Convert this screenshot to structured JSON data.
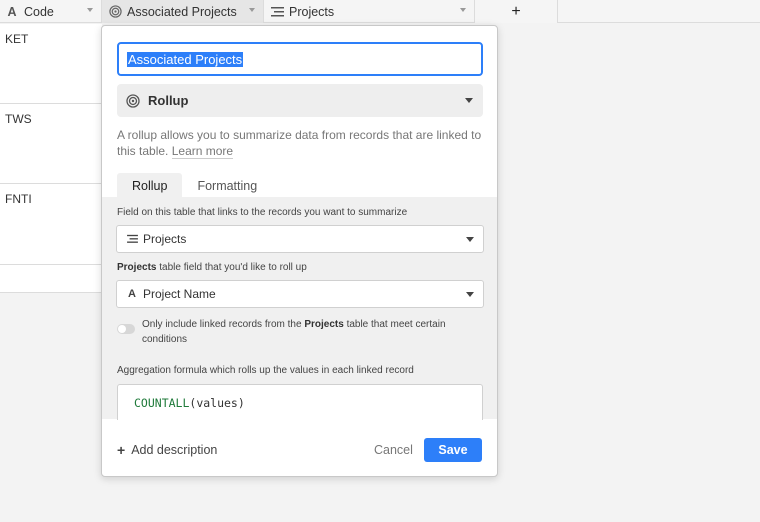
{
  "columns": [
    {
      "label": "Code",
      "icon": "text-icon"
    },
    {
      "label": "Associated Projects",
      "icon": "rollup-icon"
    },
    {
      "label": "Projects",
      "icon": "linked-records-icon"
    }
  ],
  "add_column_label": "+",
  "rows": [
    "KET",
    "TWS",
    "FNTI",
    ""
  ],
  "dialog": {
    "field_name": "Associated Projects",
    "field_type": "Rollup",
    "description_text": "A rollup allows you to summarize data from records that are linked to this table.",
    "learn_more": "Learn more",
    "tabs": [
      "Rollup",
      "Formatting"
    ],
    "link_field_label": "Field on this table that links to the records you want to summarize",
    "link_field_value": "Projects",
    "rollup_field_label_table": "Projects",
    "rollup_field_label_rest": "table field that you'd like to roll up",
    "rollup_field_value": "Project Name",
    "filter_toggle_prefix": "Only include linked records from the",
    "filter_toggle_table": "Projects",
    "filter_toggle_suffix": "table that meet certain conditions",
    "aggregation_label": "Aggregation formula which rolls up the values in each linked record",
    "formula_fn": "COUNTALL",
    "formula_args": "(values)",
    "add_description": "Add description",
    "cancel_label": "Cancel",
    "save_label": "Save"
  },
  "colors": {
    "accent": "#2d7ff9",
    "formula_fn": "#1f7a3a"
  }
}
